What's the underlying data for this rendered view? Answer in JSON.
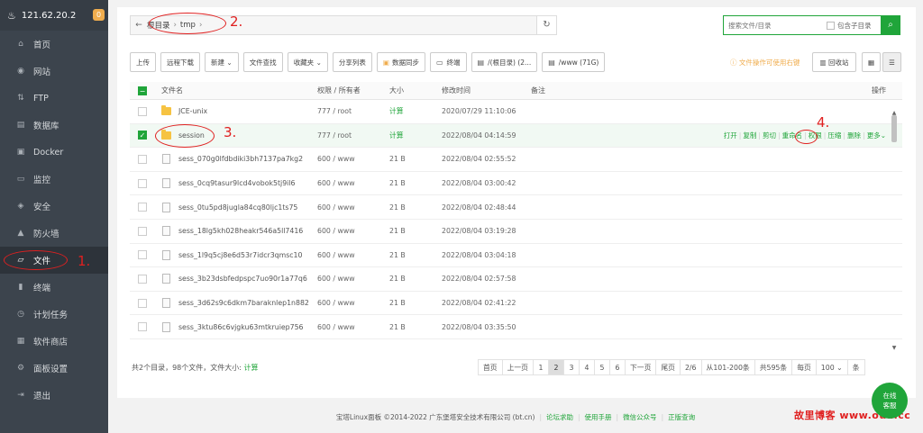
{
  "sidebar": {
    "host": "121.62.20.2",
    "badge": "0",
    "items": [
      {
        "label": "首页",
        "icon": "home-icon",
        "glyph": "⌂"
      },
      {
        "label": "网站",
        "icon": "globe-icon",
        "glyph": "◉"
      },
      {
        "label": "FTP",
        "icon": "ftp-icon",
        "glyph": "⇅"
      },
      {
        "label": "数据库",
        "icon": "database-icon",
        "glyph": "▤"
      },
      {
        "label": "Docker",
        "icon": "docker-icon",
        "glyph": "▣"
      },
      {
        "label": "监控",
        "icon": "monitor-icon",
        "glyph": "▭"
      },
      {
        "label": "安全",
        "icon": "shield-icon",
        "glyph": "◈"
      },
      {
        "label": "防火墙",
        "icon": "firewall-icon",
        "glyph": "▲"
      },
      {
        "label": "文件",
        "icon": "folder-icon",
        "glyph": "▱",
        "active": true
      },
      {
        "label": "终端",
        "icon": "terminal-icon",
        "glyph": "▮"
      },
      {
        "label": "计划任务",
        "icon": "clock-icon",
        "glyph": "◷"
      },
      {
        "label": "软件商店",
        "icon": "store-icon",
        "glyph": "▦"
      },
      {
        "label": "面板设置",
        "icon": "gear-icon",
        "glyph": "⚙"
      },
      {
        "label": "退出",
        "icon": "logout-icon",
        "glyph": "⇥"
      }
    ]
  },
  "annotations": {
    "a1": "1.",
    "a2": "2.",
    "a3": "3.",
    "a4": "4."
  },
  "path": {
    "root": "根目录",
    "dir": "tmp"
  },
  "search": {
    "placeholder": "搜索文件/目录",
    "subdir": "包含子目录"
  },
  "toolbar": {
    "upload": "上传",
    "remote": "远程下载",
    "new": "新建",
    "find": "文件查找",
    "fav": "收藏夹",
    "share": "分享列表",
    "sync": "数据同步",
    "term": "终端",
    "disk1": "/(根目录) (2...",
    "disk2": "/www (71G)"
  },
  "tip": "文件操作可使用右键",
  "recycle": "回收站",
  "table": {
    "headers": {
      "name": "文件名",
      "perm": "权限 / 所有者",
      "size": "大小",
      "time": "修改时间",
      "note": "备注",
      "ops": "操作"
    },
    "rows": [
      {
        "name": "JCE-unix",
        "perm": "777 / root",
        "size": "计算",
        "time": "2020/07/29 11:10:06"
      },
      {
        "name": "session",
        "perm": "777 / root",
        "size": "计算",
        "time": "2022/08/04 04:14:59"
      },
      {
        "name": "sess_070g0lfdbdiki3bh7137pa7kg2",
        "perm": "600 / www",
        "size": "21 B",
        "time": "2022/08/04 02:55:52"
      },
      {
        "name": "sess_0cq9tasur9lcd4vobok5tj9il6",
        "perm": "600 / www",
        "size": "21 B",
        "time": "2022/08/04 03:00:42"
      },
      {
        "name": "sess_0tu5pd8jugla84cq80ljc1ts75",
        "perm": "600 / www",
        "size": "21 B",
        "time": "2022/08/04 02:48:44"
      },
      {
        "name": "sess_18lg5kh028heakr546a5ll7416",
        "perm": "600 / www",
        "size": "21 B",
        "time": "2022/08/04 03:19:28"
      },
      {
        "name": "sess_1l9q5cj8e6d53r7idcr3qmsc10",
        "perm": "600 / www",
        "size": "21 B",
        "time": "2022/08/04 03:04:18"
      },
      {
        "name": "sess_3b23dsbfedpspc7uo90r1a77q6",
        "perm": "600 / www",
        "size": "21 B",
        "time": "2022/08/04 02:57:58"
      },
      {
        "name": "sess_3d62s9c6dkm7baraknlep1n882",
        "perm": "600 / www",
        "size": "21 B",
        "time": "2022/08/04 02:41:22"
      },
      {
        "name": "sess_3ktu86c6vjgku63mtkruiep756",
        "perm": "600 / www",
        "size": "21 B",
        "time": "2022/08/04 03:35:50"
      }
    ],
    "ops": {
      "open": "打开",
      "copy": "复制",
      "cut": "剪切",
      "rename": "重命名",
      "perm": "权限",
      "zip": "压缩",
      "del": "删除",
      "more": "更多"
    }
  },
  "summary": {
    "text": "共2个目录，98个文件，文件大小:",
    "calc": "计算"
  },
  "pager": {
    "first": "首页",
    "prev": "上一页",
    "p1": "1",
    "p2": "2",
    "p3": "3",
    "p4": "4",
    "p5": "5",
    "p6": "6",
    "next": "下一页",
    "last": "尾页",
    "pos": "2/6",
    "range": "从101-200条",
    "total": "共595条",
    "per": "每页",
    "size": "100",
    "unit": "条"
  },
  "footer": {
    "copy": "宝塔Linux面板 ©2014-2022 广东堡塔安全技术有限公司 (bt.cn)",
    "forum": "论坛求助",
    "manual": "使用手册",
    "wechat": "微信公众号",
    "auth": "正版查询"
  },
  "online": {
    "l1": "在线",
    "l2": "客服"
  },
  "watermark": "故里博客 www.oua.cc",
  "colors": {
    "accent": "#20a53a",
    "annotation": "#e02020",
    "sidebar": "#3c444d"
  }
}
